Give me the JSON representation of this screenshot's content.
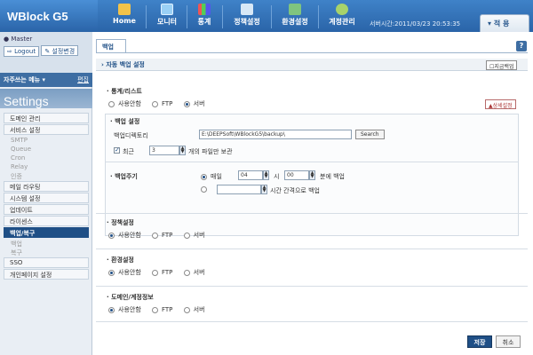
{
  "brand": {
    "name": "WBlock G5"
  },
  "nav": {
    "home": "Home",
    "monitor": "모니터",
    "stats": "통계",
    "policy": "정책설정",
    "env": "환경설정",
    "account": "계정관리",
    "server_time": "서버시간:2011/03/23 20:53:35",
    "apply": "적 용"
  },
  "sidebar": {
    "user": "Master",
    "logout": "Logout",
    "change_settings": "설정변경",
    "favorites": "자주쓰는 메뉴",
    "edit": "편집",
    "settings": "Settings",
    "items": [
      {
        "label": "도메인 관리"
      },
      {
        "label": "서비스 설정"
      },
      {
        "label": "SMTP"
      },
      {
        "label": "Queue"
      },
      {
        "label": "Cron"
      },
      {
        "label": "Relay"
      },
      {
        "label": "인증"
      },
      {
        "label": "메일 라우팅"
      },
      {
        "label": "시스템 설정"
      },
      {
        "label": "업데이트"
      },
      {
        "label": "라이센스"
      },
      {
        "label": "백업/복구"
      },
      {
        "label": "백업"
      },
      {
        "label": "복구"
      },
      {
        "label": "SSO"
      },
      {
        "label": "개인페이지 설정"
      }
    ]
  },
  "main": {
    "tab": "백업",
    "help": "?",
    "section_title": "자동 백업 설정",
    "backup_now": "지금백업",
    "stats_logs": {
      "title": "통계/리스트",
      "options": [
        "사용안함",
        "FTP",
        "서버"
      ],
      "selected": "서버",
      "detail_button": "상세설정"
    },
    "backup_settings": {
      "title": "백업 설정",
      "dir_label": "백업디렉토리",
      "dir_value": "E:\\DEEPSoft\\WBlockG5\\backup\\",
      "search_button": "Search",
      "recent_label": "최근",
      "recent_value": "3",
      "recent_suffix": "개의 파일만 보관"
    },
    "backup_cycle": {
      "title": "백업주기",
      "daily_label": "매일",
      "hour_value": "04",
      "hour_suffix": "시",
      "minute_value": "00",
      "minute_suffix": "분에 백업",
      "interval_suffix": "시간 간격으로 백업"
    },
    "policy": {
      "title": "정책설정",
      "options": [
        "사용안함",
        "FTP",
        "서버"
      ],
      "selected": "사용안함"
    },
    "environment": {
      "title": "환경설정",
      "options": [
        "사용안함",
        "FTP",
        "서버"
      ],
      "selected": "사용안함"
    },
    "domain_account": {
      "title": "도메인/계정정보",
      "options": [
        "사용안함",
        "FTP",
        "서버"
      ],
      "selected": "사용안함"
    },
    "save": "저장",
    "cancel": "취소"
  },
  "colors": {
    "topbar": "#2a64a8",
    "accent": "#1f4f86",
    "sidebar": "#e9eef4"
  }
}
